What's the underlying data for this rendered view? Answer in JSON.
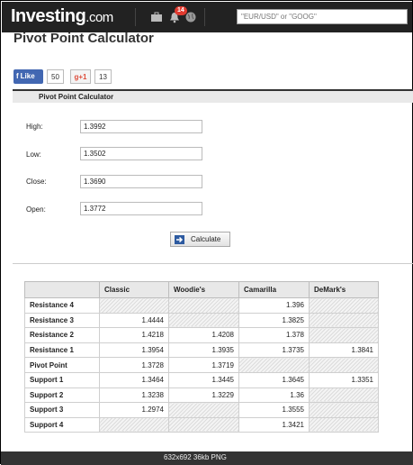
{
  "header": {
    "logo_text": "Investing",
    "logo_suffix": ".com",
    "notification_count": "14",
    "search_placeholder": "\"EUR/USD\" or \"GOOG\"",
    "icons": [
      "briefcase-icon",
      "bell-icon",
      "globe-icon"
    ]
  },
  "page": {
    "title": "Pivot Point Calculator"
  },
  "social": {
    "like_label": "Like",
    "like_count": "50",
    "gplus_label": "g+1",
    "gplus_count": "13"
  },
  "panel": {
    "title": "Pivot Point Calculator"
  },
  "form": {
    "high_label": "High:",
    "high_value": "1.3992",
    "low_label": "Low:",
    "low_value": "1.3502",
    "close_label": "Close:",
    "close_value": "1.3690",
    "open_label": "Open:",
    "open_value": "1.3772",
    "calculate_label": "Calculate"
  },
  "table": {
    "headers": [
      "",
      "Classic",
      "Woodie's",
      "Camarilla",
      "DeMark's"
    ],
    "rows": [
      {
        "label": "Resistance 4",
        "values": [
          "",
          "",
          "1.396",
          ""
        ]
      },
      {
        "label": "Resistance 3",
        "values": [
          "1.4444",
          "",
          "1.3825",
          ""
        ]
      },
      {
        "label": "Resistance 2",
        "values": [
          "1.4218",
          "1.4208",
          "1.378",
          ""
        ]
      },
      {
        "label": "Resistance 1",
        "values": [
          "1.3954",
          "1.3935",
          "1.3735",
          "1.3841"
        ]
      },
      {
        "label": "Pivot Point",
        "values": [
          "1.3728",
          "1.3719",
          "",
          ""
        ]
      },
      {
        "label": "Support 1",
        "values": [
          "1.3464",
          "1.3445",
          "1.3645",
          "1.3351"
        ]
      },
      {
        "label": "Support 2",
        "values": [
          "1.3238",
          "1.3229",
          "1.36",
          ""
        ]
      },
      {
        "label": "Support 3",
        "values": [
          "1.2974",
          "",
          "1.3555",
          ""
        ]
      },
      {
        "label": "Support 4",
        "values": [
          "",
          "",
          "1.3421",
          ""
        ]
      }
    ]
  },
  "footer": {
    "image_info": "632x692  36kb  PNG"
  },
  "colors": {
    "topbar": "#222222",
    "badge": "#e03a2f",
    "facebook": "#4267b2",
    "gplus": "#dd4b39"
  }
}
